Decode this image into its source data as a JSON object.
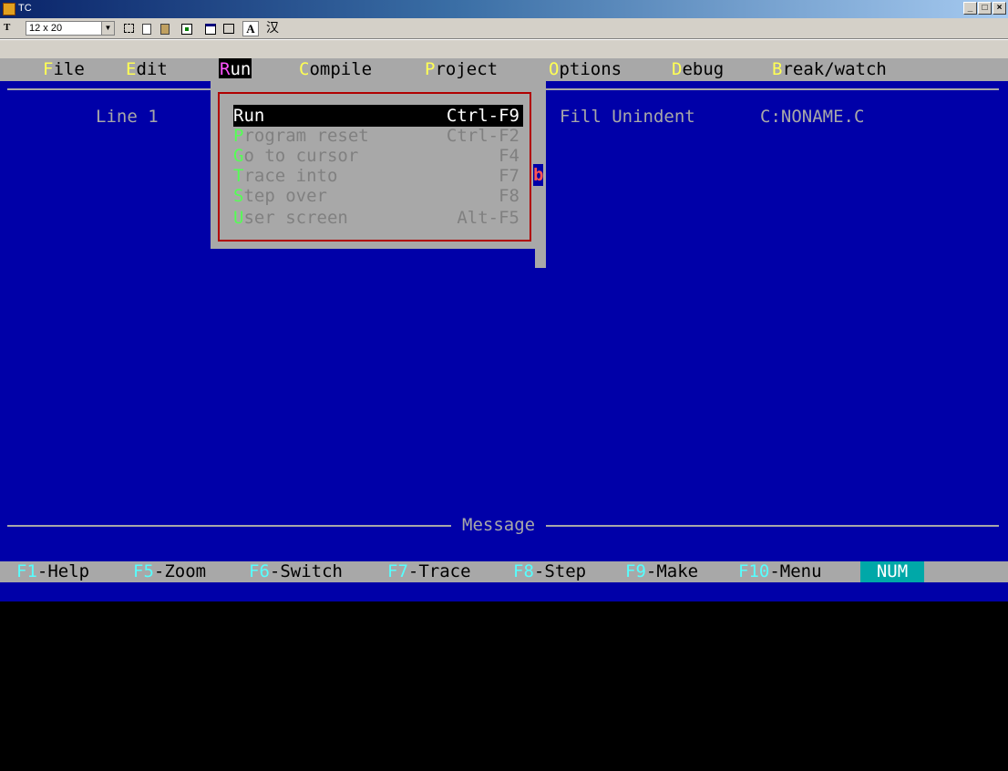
{
  "window": {
    "title": "TC",
    "buttons": [
      "_",
      "□",
      "×"
    ]
  },
  "toolbar": {
    "font_label": "T",
    "font_size": "12 x 20",
    "icons": [
      "mark-icon",
      "copy-icon",
      "paste-icon",
      "fullscreen-icon",
      "properties-icon",
      "background-icon",
      "font-icon",
      "ime-icon"
    ],
    "font_button": "A",
    "ime_button": "汉"
  },
  "menubar": {
    "items": [
      {
        "hot": "F",
        "rest": "ile"
      },
      {
        "hot": "E",
        "rest": "dit"
      },
      {
        "hot": "R",
        "rest": "un"
      },
      {
        "hot": "C",
        "rest": "ompile"
      },
      {
        "hot": "P",
        "rest": "roject"
      },
      {
        "hot": "O",
        "rest": "ptions"
      },
      {
        "hot": "D",
        "rest": "ebug"
      },
      {
        "hot": "B",
        "rest": "reak/watch"
      }
    ]
  },
  "editor": {
    "line": "Line 1",
    "mode_flags": "Fill Unindent",
    "filename": "C:NONAME.C",
    "marker": "b"
  },
  "run_menu": {
    "items": [
      {
        "hot": "",
        "rest": "Run",
        "shortcut": "Ctrl-F9",
        "selected": true
      },
      {
        "hot": "P",
        "rest": "rogram reset",
        "shortcut": "Ctrl-F2"
      },
      {
        "hot": "G",
        "rest": "o to cursor",
        "shortcut": "F4"
      },
      {
        "hot": "T",
        "rest": "race into",
        "shortcut": "F7"
      },
      {
        "hot": "S",
        "rest": "tep over",
        "shortcut": "F8"
      },
      {
        "hot": "U",
        "rest": "ser screen",
        "shortcut": "Alt-F5"
      }
    ]
  },
  "message_window": {
    "label": "Message"
  },
  "function_keys": [
    {
      "key": "F1",
      "label": "-Help"
    },
    {
      "key": "F5",
      "label": "-Zoom"
    },
    {
      "key": "F6",
      "label": "-Switch"
    },
    {
      "key": "F7",
      "label": "-Trace"
    },
    {
      "key": "F8",
      "label": "-Step"
    },
    {
      "key": "F9",
      "label": "-Make"
    },
    {
      "key": "F10",
      "label": "-Menu"
    }
  ],
  "num_indicator": "NUM",
  "colors": {
    "screen": "#0000a8",
    "menu": "#a8a8a8",
    "hotkey": "#ffff54",
    "highlight_frame": "#b00000"
  }
}
